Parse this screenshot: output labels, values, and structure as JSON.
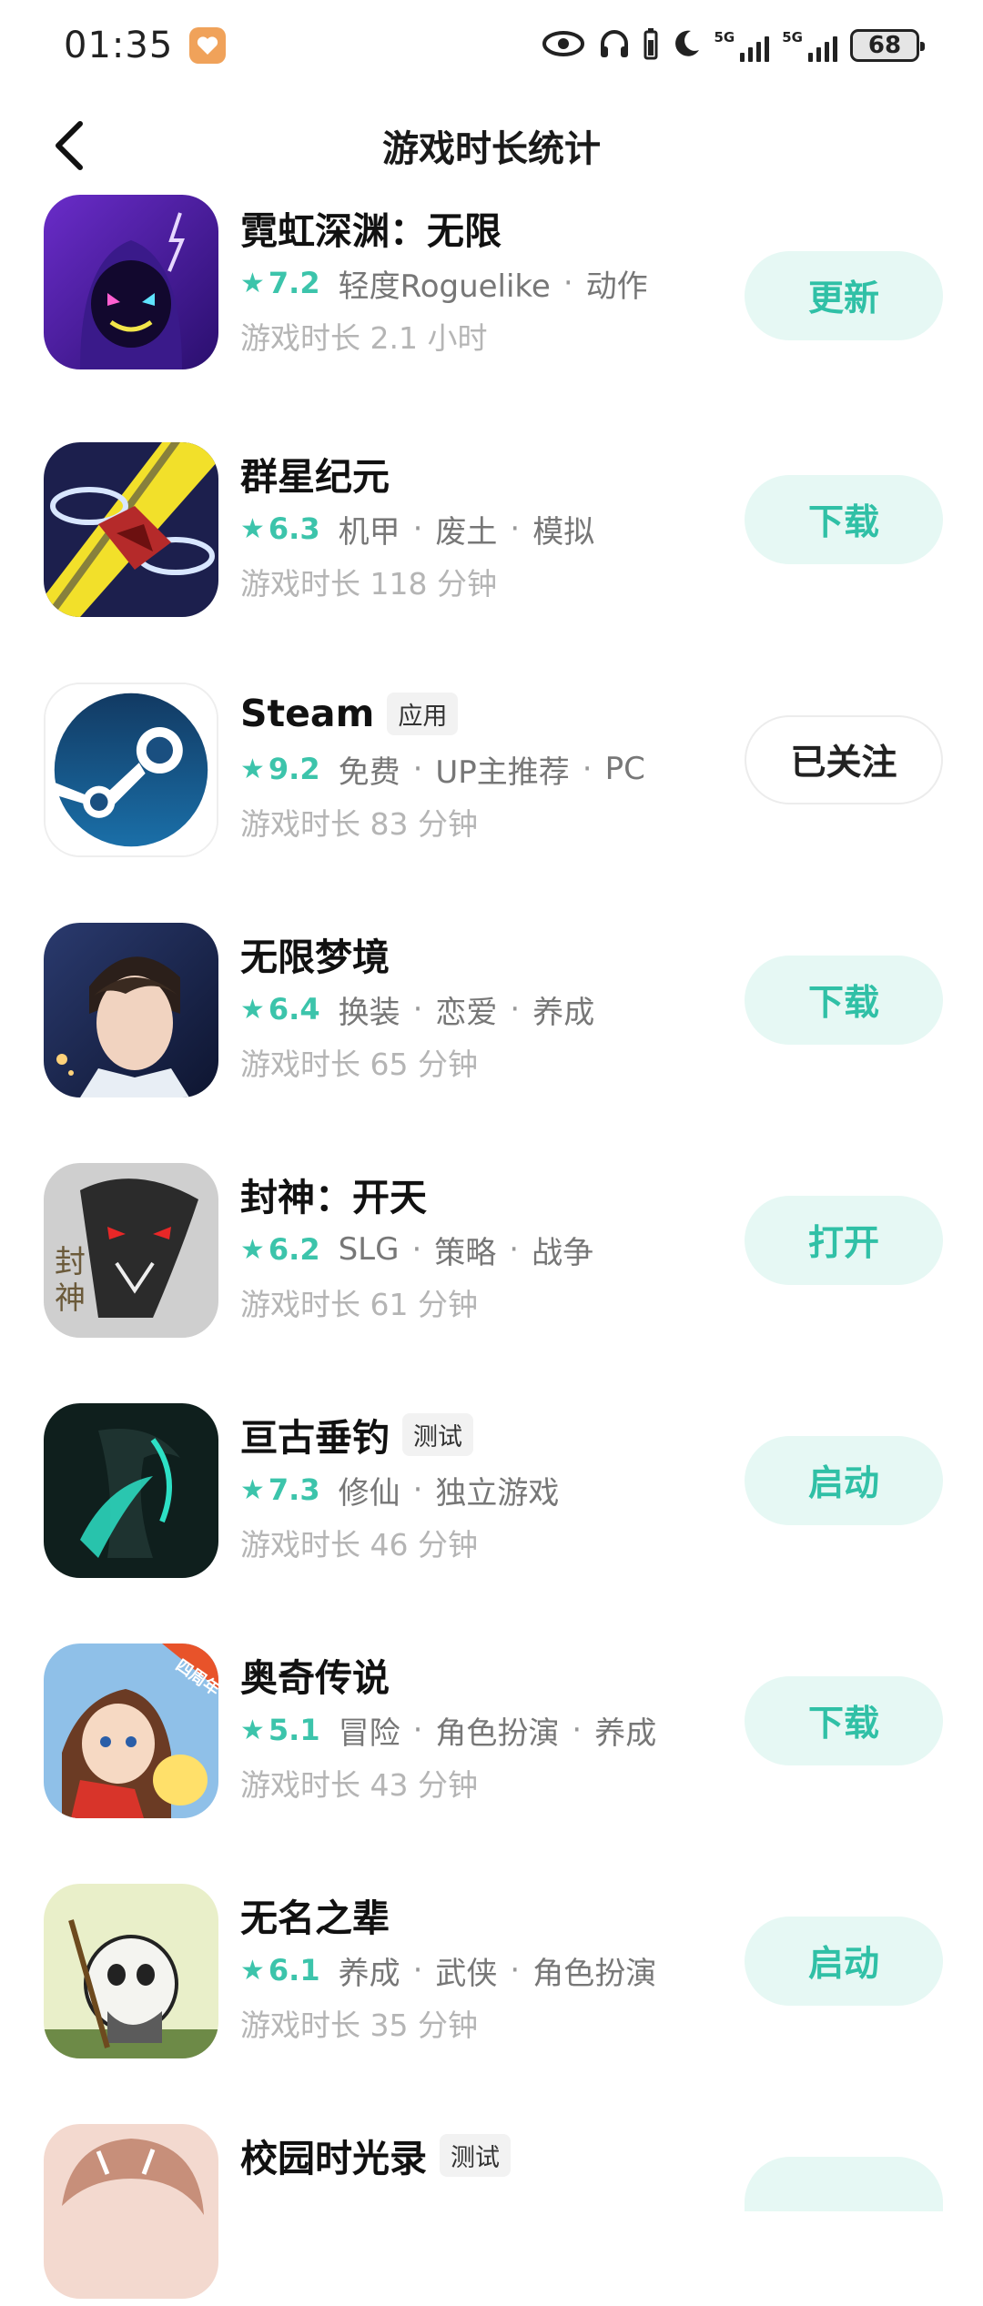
{
  "status_bar": {
    "time": "01:35",
    "network_1": "5G",
    "network_2": "5G",
    "battery": "68"
  },
  "header": {
    "title": "游戏时长统计"
  },
  "games": [
    {
      "name": "霓虹深渊：无限",
      "tag": "",
      "rating": "7.2",
      "genres": [
        "轻度Roguelike",
        "动作"
      ],
      "playtime": "游戏时长 2.1 小时",
      "action": "更新",
      "icon": "neon-abyss-icon"
    },
    {
      "name": "群星纪元",
      "tag": "",
      "rating": "6.3",
      "genres": [
        "机甲",
        "废土",
        "模拟"
      ],
      "playtime": "游戏时长 118 分钟",
      "action": "下载",
      "icon": "stellar-era-icon"
    },
    {
      "name": "Steam",
      "tag": "应用",
      "rating": "9.2",
      "genres": [
        "免费",
        "UP主推荐",
        "PC"
      ],
      "playtime": "游戏时长 83 分钟",
      "action": "已关注",
      "icon": "steam-icon"
    },
    {
      "name": "无限梦境",
      "tag": "",
      "rating": "6.4",
      "genres": [
        "换装",
        "恋爱",
        "养成"
      ],
      "playtime": "游戏时长 65 分钟",
      "action": "下载",
      "icon": "infinite-dream-icon"
    },
    {
      "name": "封神：开天",
      "tag": "",
      "rating": "6.2",
      "genres": [
        "SLG",
        "策略",
        "战争"
      ],
      "playtime": "游戏时长 61 分钟",
      "action": "打开",
      "icon": "fengshen-icon"
    },
    {
      "name": "亘古垂钓",
      "tag": "测试",
      "rating": "7.3",
      "genres": [
        "修仙",
        "独立游戏"
      ],
      "playtime": "游戏时长 46 分钟",
      "action": "启动",
      "icon": "ancient-fishing-icon"
    },
    {
      "name": "奥奇传说",
      "tag": "",
      "rating": "5.1",
      "genres": [
        "冒险",
        "角色扮演",
        "养成"
      ],
      "playtime": "游戏时长 43 分钟",
      "action": "下载",
      "icon": "aoqi-legend-icon",
      "icon_ribbon": "四周年"
    },
    {
      "name": "无名之辈",
      "tag": "",
      "rating": "6.1",
      "genres": [
        "养成",
        "武侠",
        "角色扮演"
      ],
      "playtime": "游戏时长 35 分钟",
      "action": "启动",
      "icon": "nameless-icon"
    },
    {
      "name": "校园时光录",
      "tag": "测试",
      "rating": "",
      "genres": [],
      "playtime": "",
      "action": "",
      "icon": "campus-time-icon"
    }
  ],
  "colors": {
    "accent": "#30c0a6",
    "accent_bg": "#e6f8f4",
    "muted": "#b5b5b5"
  }
}
